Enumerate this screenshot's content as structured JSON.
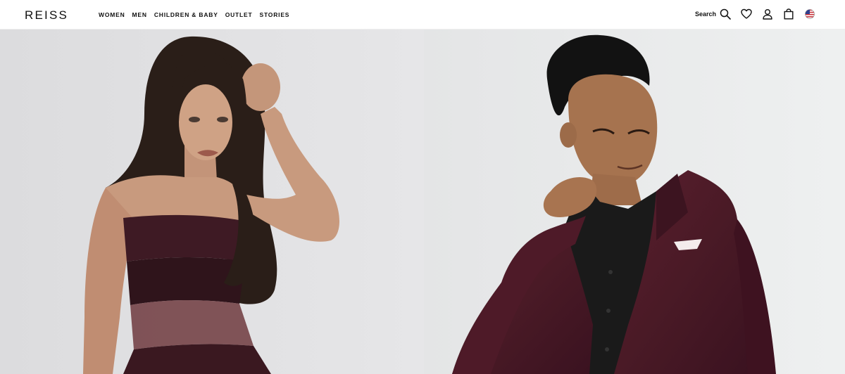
{
  "brand": {
    "logo": "REISS"
  },
  "nav": {
    "items": [
      {
        "label": "WOMEN"
      },
      {
        "label": "MEN"
      },
      {
        "label": "CHILDREN & BABY"
      },
      {
        "label": "OUTLET"
      },
      {
        "label": "STORIES"
      }
    ]
  },
  "utilities": {
    "search_label": "Search",
    "icons": [
      "search-icon",
      "heart-icon",
      "account-icon",
      "bag-icon",
      "us-flag-icon"
    ]
  },
  "hero": {
    "panels": [
      {
        "subject": "women"
      },
      {
        "subject": "men"
      }
    ]
  },
  "colors": {
    "header_bg": "#ffffff",
    "text": "#111111",
    "left_bg": "#e3e3e5",
    "right_bg": "#e9eaeb",
    "burgundy": "#4a1a26",
    "skin": "#c89a7e",
    "hair": "#2a1e18"
  }
}
